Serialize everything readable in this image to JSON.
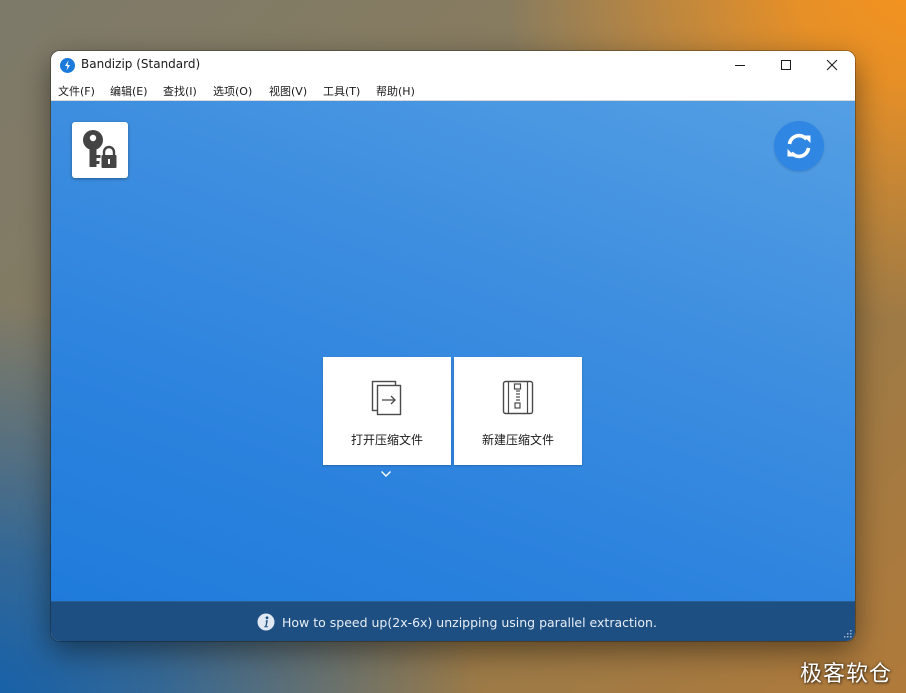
{
  "window": {
    "title": "Bandizip (Standard)"
  },
  "menu": {
    "items": [
      {
        "label": "文件(F)"
      },
      {
        "label": "编辑(E)"
      },
      {
        "label": "查找(I)"
      },
      {
        "label": "选项(O)"
      },
      {
        "label": "视图(V)"
      },
      {
        "label": "工具(T)"
      },
      {
        "label": "帮助(H)"
      }
    ]
  },
  "main": {
    "tiles": [
      {
        "label": "打开压缩文件",
        "icon": "open-archive-icon"
      },
      {
        "label": "新建压缩文件",
        "icon": "new-archive-icon"
      }
    ],
    "key_icon": "password-manager-icon",
    "refresh_icon": "refresh-icon"
  },
  "status": {
    "icon": "info-icon",
    "text": "How to speed up(2x-6x) unzipping using parallel extraction."
  },
  "watermark": {
    "text": "极客软仓"
  },
  "colors": {
    "accent": "#1f7bdb",
    "status_bar": "#1d4f82",
    "refresh_button": "#2f86e3"
  }
}
